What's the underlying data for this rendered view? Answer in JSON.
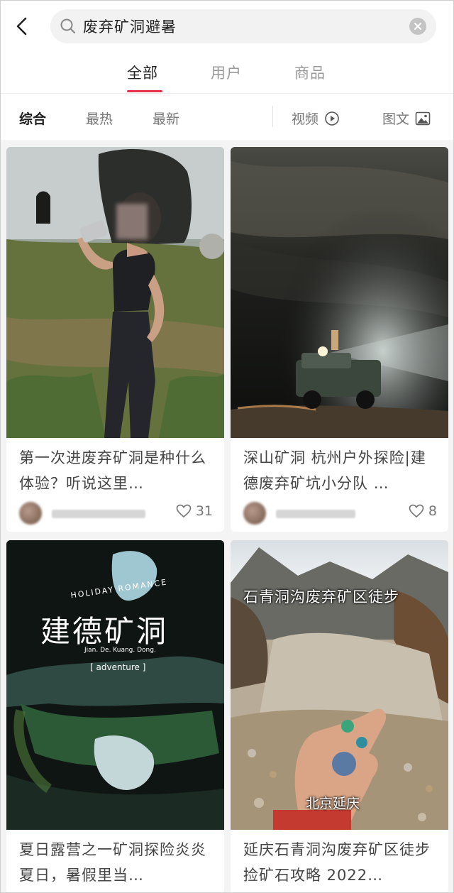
{
  "search": {
    "query": "废弃矿洞避暑"
  },
  "tabs": [
    {
      "label": "全部"
    },
    {
      "label": "用户"
    },
    {
      "label": "商品"
    }
  ],
  "filters": {
    "comprehensive": "综合",
    "hottest": "最热",
    "latest": "最新",
    "video": "视频",
    "image_text": "图文"
  },
  "colors": {
    "accent": "#e8344a"
  },
  "cards": [
    {
      "title": "第一次进废弃矿洞是种什么体验？听说这里…",
      "likes": "31"
    },
    {
      "title": "深山矿洞 杭州户外探险|建德废弃矿坑小分队 …",
      "likes": "8"
    },
    {
      "title": "夏日露营之一矿洞探险炎炎夏日，暑假里当…",
      "overlay": {
        "small": "HOLIDAY ROMANCE",
        "big": "建德矿洞",
        "pinyin": "Jian. De. Kuang. Dong.",
        "tag": "[ adventure ]"
      }
    },
    {
      "title": "延庆石青洞沟废弃矿区徒步捡矿石攻略 2022…",
      "overlay": {
        "top": "石青洞沟废弃矿区徒步",
        "bottom": "北京延庆"
      }
    }
  ]
}
